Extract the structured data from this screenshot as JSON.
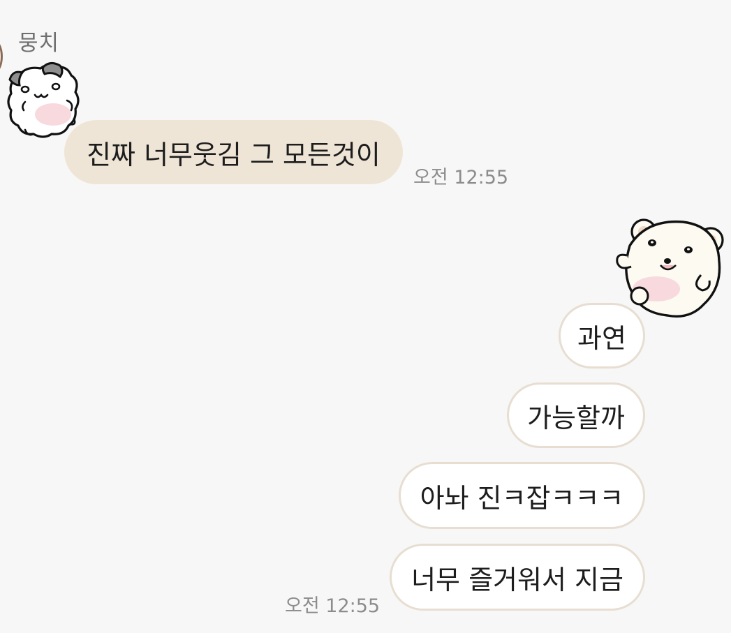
{
  "chat": {
    "sender_name": "뭉치",
    "incoming": {
      "text": "진짜 너무웃김 그 모든것이",
      "time": "오전 12:55",
      "bubble_color": "#efe5d6"
    },
    "outgoing": {
      "messages": [
        "과연",
        "가능할까",
        "아놔 진ㅋ잡ㅋㅋㅋ",
        "너무 즐거워서 지금"
      ],
      "time": "오전 12:55",
      "bubble_color": "#ffffff",
      "border_color": "#e7ded1"
    },
    "stickers": {
      "left": "hamster-sticker-icon",
      "right": "polar-bear-sticker-icon"
    }
  }
}
